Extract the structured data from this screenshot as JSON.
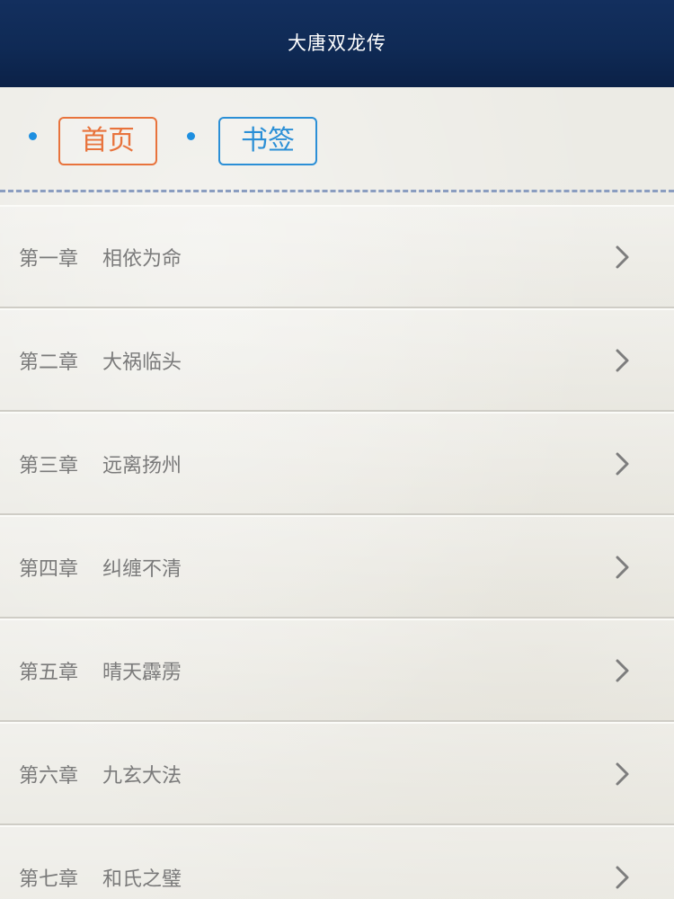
{
  "header": {
    "title": "大唐双龙传"
  },
  "tabs": {
    "home_label": "首页",
    "bookmark_label": "书签"
  },
  "chapters": [
    {
      "num": "第一章",
      "title": "相依为命"
    },
    {
      "num": "第二章",
      "title": "大祸临头"
    },
    {
      "num": "第三章",
      "title": "远离扬州"
    },
    {
      "num": "第四章",
      "title": "纠缠不清"
    },
    {
      "num": "第五章",
      "title": "晴天霹雳"
    },
    {
      "num": "第六章",
      "title": "九玄大法"
    },
    {
      "num": "第七章",
      "title": "和氏之璧"
    }
  ],
  "colors": {
    "header_bg": "#0f2a55",
    "home_tab": "#e8733c",
    "bookmark_tab": "#2b8fd6",
    "dot": "#1e8fe0",
    "dashed_line": "#8a9dc0",
    "row_text": "#7a7a7a"
  },
  "icons": {
    "row_arrow": "chevron-right-icon",
    "bullet": "dot-icon"
  }
}
